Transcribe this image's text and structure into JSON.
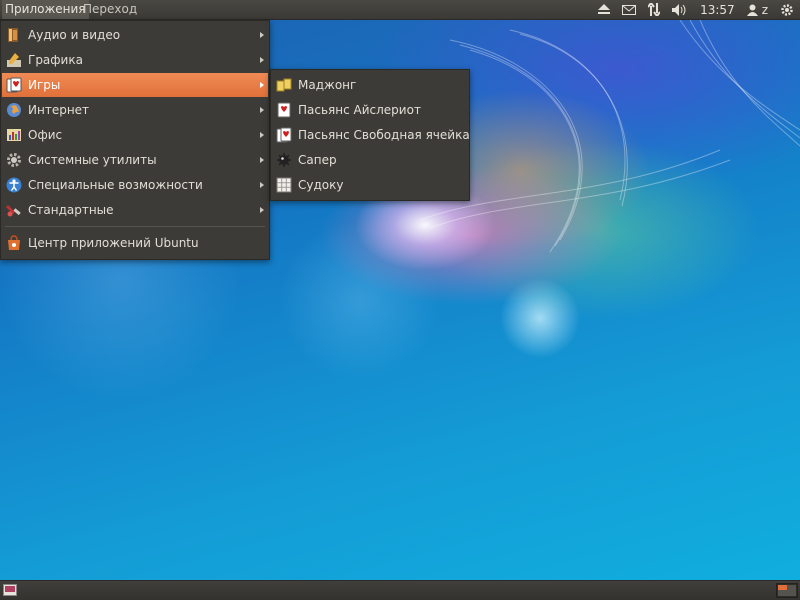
{
  "top_panel": {
    "menus": [
      "Приложения",
      "Переход"
    ],
    "tray": {
      "eject_icon": "eject-icon",
      "mail_icon": "mail-icon",
      "network_icon": "network-arrows-icon",
      "volume_icon": "volume-icon",
      "clock": "13:57",
      "user": "z",
      "session_icon": "gear-icon"
    }
  },
  "apps_menu": {
    "items": [
      {
        "label": "Аудио и видео",
        "icon": "audio-video-icon",
        "submenu": true
      },
      {
        "label": "Графика",
        "icon": "graphics-icon",
        "submenu": true
      },
      {
        "label": "Игры",
        "icon": "games-icon",
        "submenu": true,
        "highlighted": true
      },
      {
        "label": "Интернет",
        "icon": "internet-icon",
        "submenu": true
      },
      {
        "label": "Офис",
        "icon": "office-icon",
        "submenu": true
      },
      {
        "label": "Системные утилиты",
        "icon": "system-tools-icon",
        "submenu": true
      },
      {
        "label": "Специальные возможности",
        "icon": "accessibility-icon",
        "submenu": true
      },
      {
        "label": "Стандартные",
        "icon": "accessories-icon",
        "submenu": true
      }
    ],
    "software_center": {
      "label": "Центр приложений Ubuntu",
      "icon": "software-center-icon"
    }
  },
  "games_menu": {
    "items": [
      {
        "label": "Маджонг",
        "icon": "mahjongg-icon"
      },
      {
        "label": "Пасьянс Айслериот",
        "icon": "aisleriot-icon"
      },
      {
        "label": "Пасьянс Свободная ячейка",
        "icon": "freecell-icon"
      },
      {
        "label": "Сапер",
        "icon": "mines-icon"
      },
      {
        "label": "Судоку",
        "icon": "sudoku-icon"
      }
    ]
  },
  "colors": {
    "highlight": "#e0703a",
    "menu_bg": "#3c3b37",
    "panel_bg": "#3a3935"
  }
}
